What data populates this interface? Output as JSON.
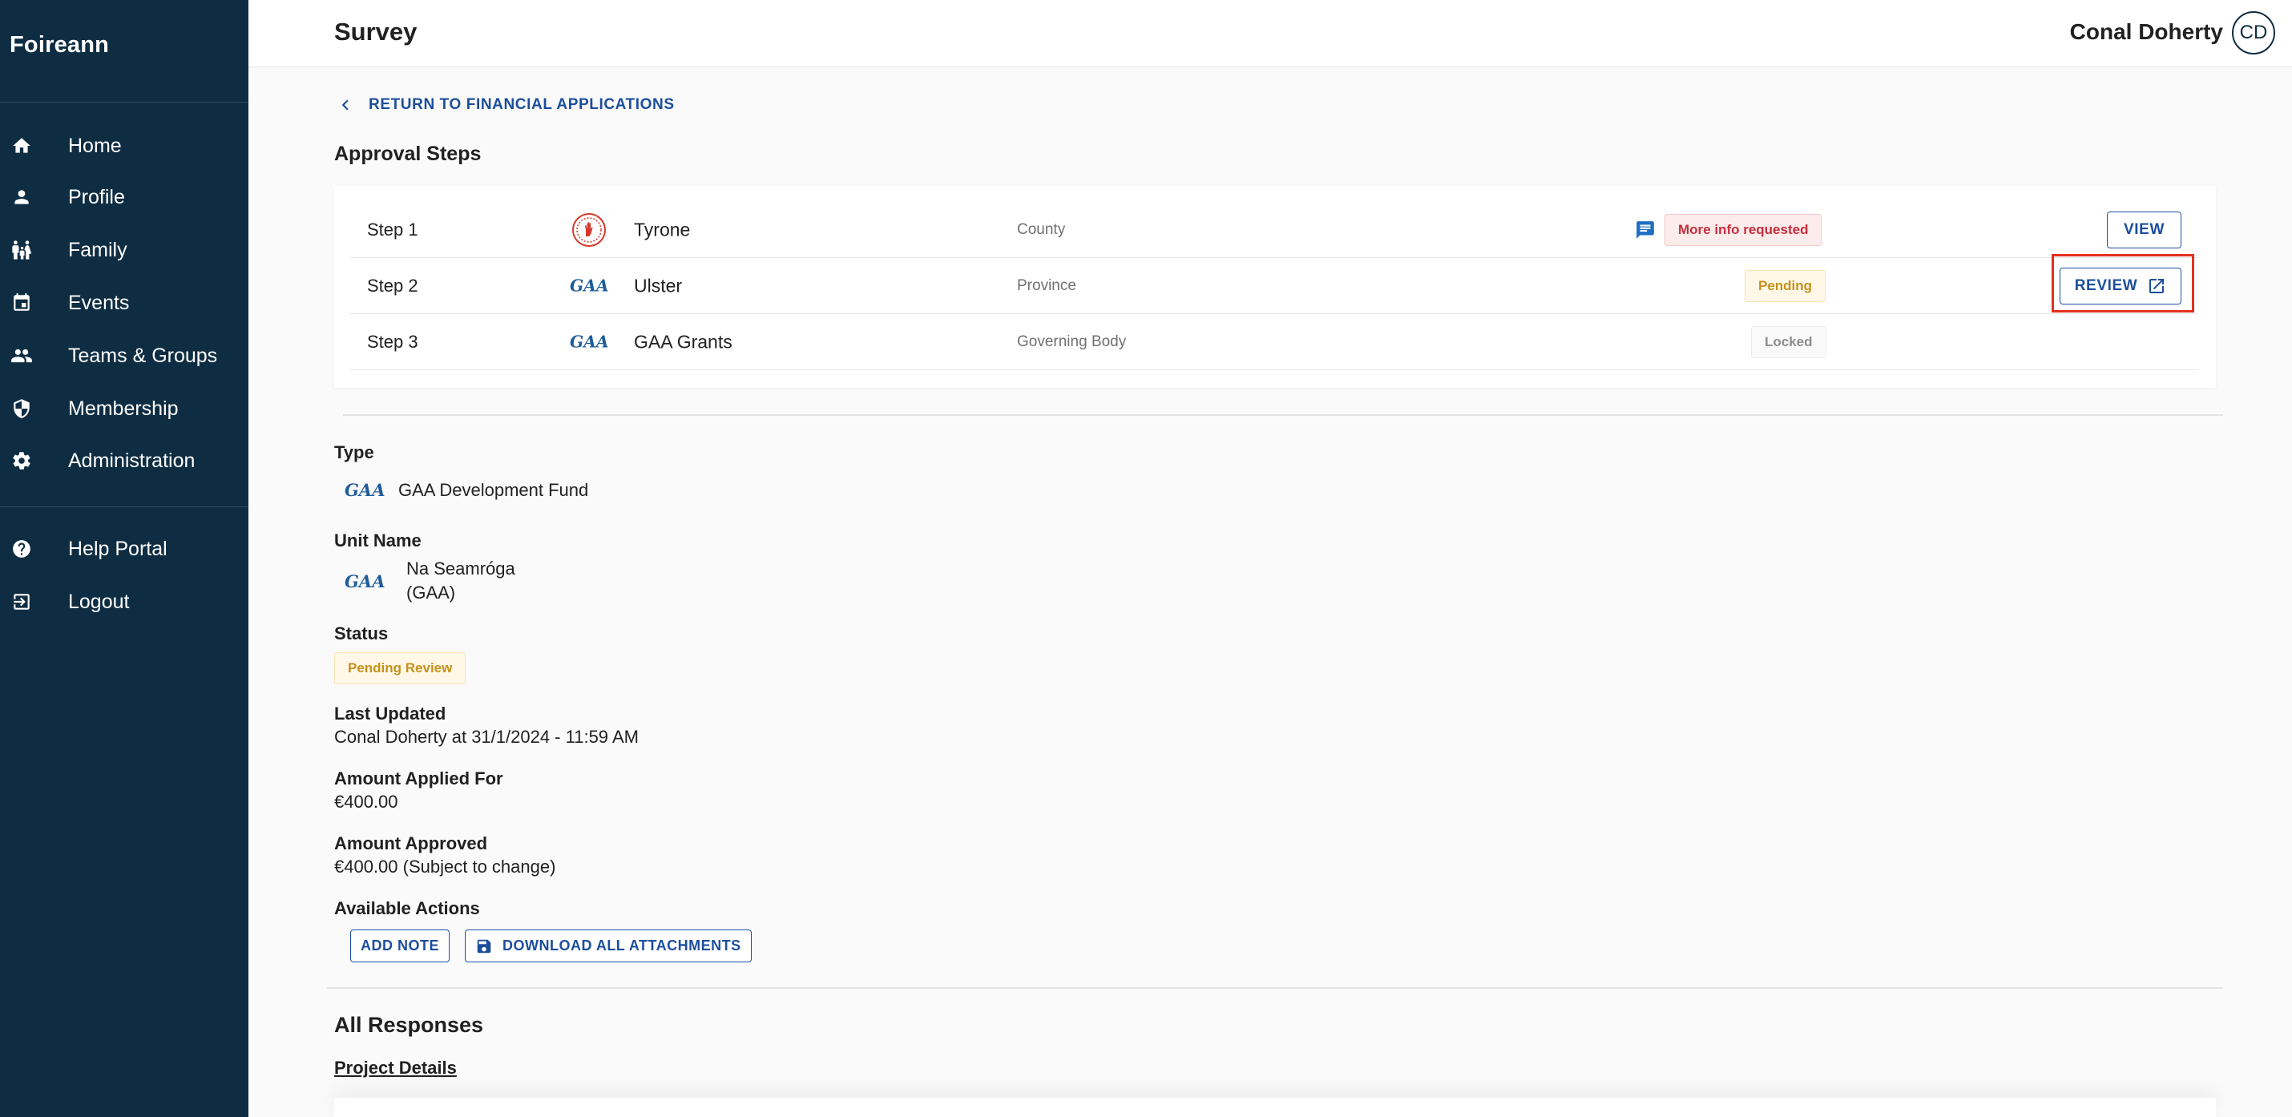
{
  "app": {
    "brand": "Foireann"
  },
  "sidebar": {
    "items": [
      {
        "label": "Home",
        "icon": "home-icon"
      },
      {
        "label": "Profile",
        "icon": "person-icon"
      },
      {
        "label": "Family",
        "icon": "family-icon"
      },
      {
        "label": "Events",
        "icon": "calendar-icon"
      },
      {
        "label": "Teams & Groups",
        "icon": "groups-icon"
      },
      {
        "label": "Membership",
        "icon": "shield-icon"
      },
      {
        "label": "Administration",
        "icon": "gear-icon"
      }
    ],
    "secondary_items": [
      {
        "label": "Help Portal",
        "icon": "help-icon"
      },
      {
        "label": "Logout",
        "icon": "logout-icon"
      }
    ]
  },
  "header": {
    "title": "Survey",
    "user_name": "Conal Doherty",
    "avatar_initials": "CD"
  },
  "main": {
    "back_link": "RETURN TO FINANCIAL APPLICATIONS",
    "approval_heading": "Approval Steps",
    "steps": [
      {
        "step": "Step 1",
        "name": "Tyrone",
        "level": "County",
        "status": "More info requested",
        "action": "VIEW"
      },
      {
        "step": "Step 2",
        "name": "Ulster",
        "level": "Province",
        "status": "Pending",
        "action": "REVIEW"
      },
      {
        "step": "Step 3",
        "name": "GAA Grants",
        "level": "Governing Body",
        "status": "Locked",
        "action": ""
      }
    ],
    "details": {
      "type_label": "Type",
      "type_value": "GAA Development Fund",
      "unit_label": "Unit Name",
      "unit_value_line1": "Na Seamróga",
      "unit_value_line2": "(GAA)",
      "status_label": "Status",
      "status_value": "Pending Review",
      "last_updated_label": "Last Updated",
      "last_updated_value": "Conal Doherty at 31/1/2024 - 11:59 AM",
      "amount_applied_label": "Amount Applied For",
      "amount_applied_value": "€400.00",
      "amount_approved_label": "Amount Approved",
      "amount_approved_value": "€400.00 (Subject to change)",
      "actions_label": "Available Actions",
      "add_note": "ADD NOTE",
      "download_all": "DOWNLOAD ALL ATTACHMENTS"
    },
    "responses_heading": "All Responses",
    "project_details_link": "Project Details"
  },
  "colors": {
    "sidebar_bg": "#0f2d42",
    "accent_blue": "#1c4e9c",
    "info_red": "#c62e3c",
    "pending_amber": "#c7911b",
    "highlight_red": "#e3311f"
  }
}
